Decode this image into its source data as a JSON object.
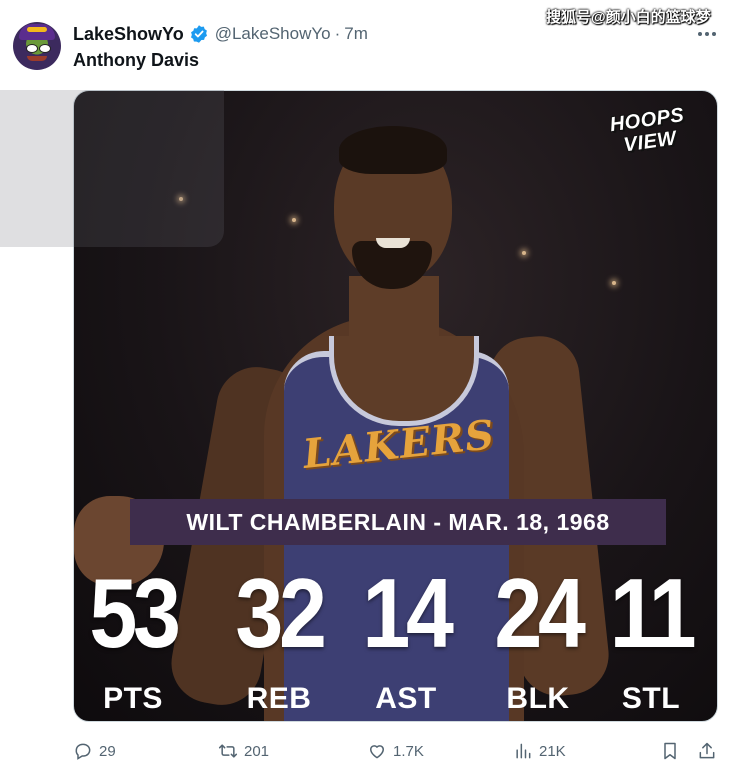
{
  "watermark": "搜狐号@颜小白的篮球梦",
  "author": {
    "display_name": "LakeShowYo",
    "handle": "@LakeShowYo",
    "separator": "·",
    "time": "7m"
  },
  "tweet": {
    "text": "Anthony Davis"
  },
  "media": {
    "logo_line1": "HOOPS",
    "logo_line2": "VIEW",
    "jersey_text": "LAKERS",
    "banner": "WILT CHAMBERLAIN - MAR. 18, 1968",
    "stats": [
      {
        "value": "53",
        "label": "PTS"
      },
      {
        "value": "32",
        "label": "REB"
      },
      {
        "value": "14",
        "label": "AST"
      },
      {
        "value": "24",
        "label": "BLK"
      },
      {
        "value": "11",
        "label": "STL"
      }
    ]
  },
  "actions": {
    "replies": "29",
    "retweets": "201",
    "likes": "1.7K",
    "views": "21K"
  },
  "colors": {
    "verified": "#1d9bf0",
    "banner_bg": "#3e2d4c",
    "muted": "#536471"
  }
}
